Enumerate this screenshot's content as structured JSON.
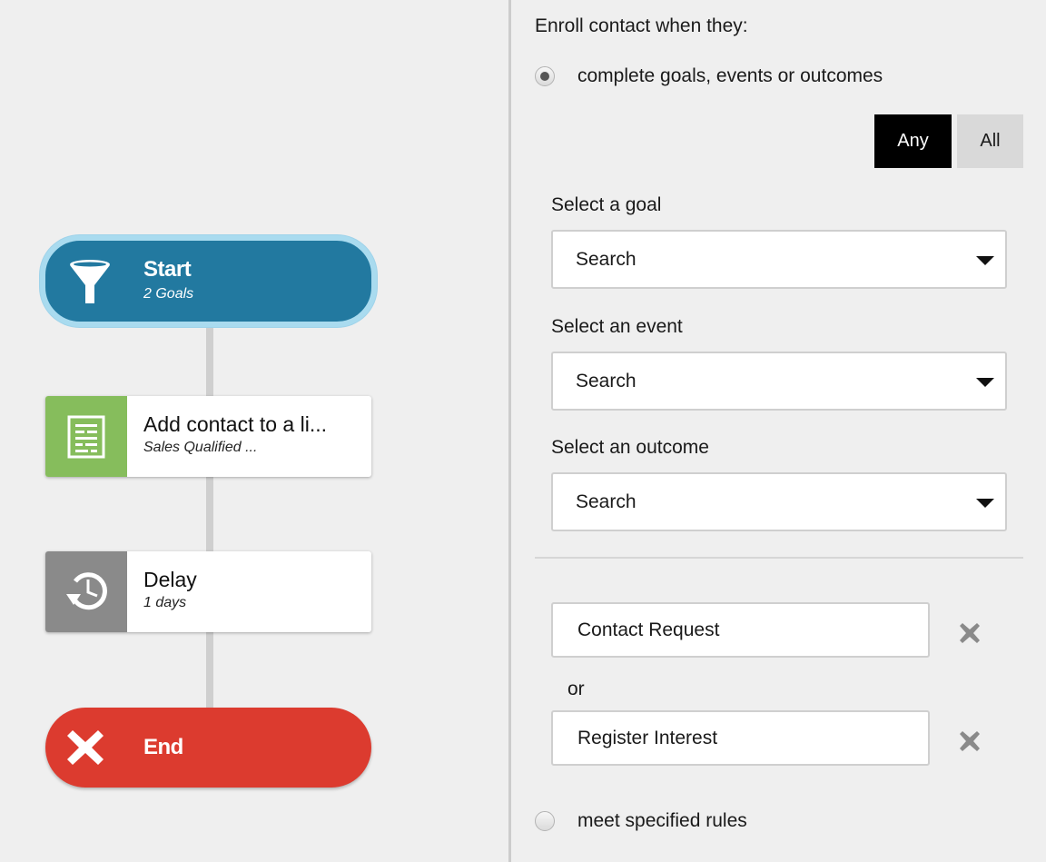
{
  "workflow": {
    "nodes": [
      {
        "type": "start",
        "title": "Start",
        "subtitle": "2 Goals",
        "icon": "funnel-icon",
        "color": "#2279a0"
      },
      {
        "type": "action",
        "title": "Add contact to a li...",
        "subtitle": "Sales Qualified ...",
        "icon": "list-document-icon",
        "color": "#86bd5c"
      },
      {
        "type": "delay",
        "title": "Delay",
        "subtitle": "1 days",
        "icon": "clock-history-icon",
        "color": "#8a8a8a"
      },
      {
        "type": "end",
        "title": "End",
        "icon": "close-x-icon",
        "color": "#dc3b2f"
      }
    ]
  },
  "panel": {
    "heading": "Enroll contact when they:",
    "option_goals": {
      "label": "complete goals, events or outcomes",
      "selected": true
    },
    "option_rules": {
      "label": "meet specified rules",
      "selected": false
    },
    "match_toggle": {
      "any_label": "Any",
      "all_label": "All",
      "selected": "Any"
    },
    "goal_select": {
      "label": "Select a goal",
      "placeholder": "Search"
    },
    "event_select": {
      "label": "Select an event",
      "placeholder": "Search"
    },
    "outcome_select": {
      "label": "Select an outcome",
      "placeholder": "Search"
    },
    "selected_items": [
      {
        "label": "Contact Request"
      },
      {
        "label": "Register Interest"
      }
    ],
    "separator_label": "or"
  }
}
